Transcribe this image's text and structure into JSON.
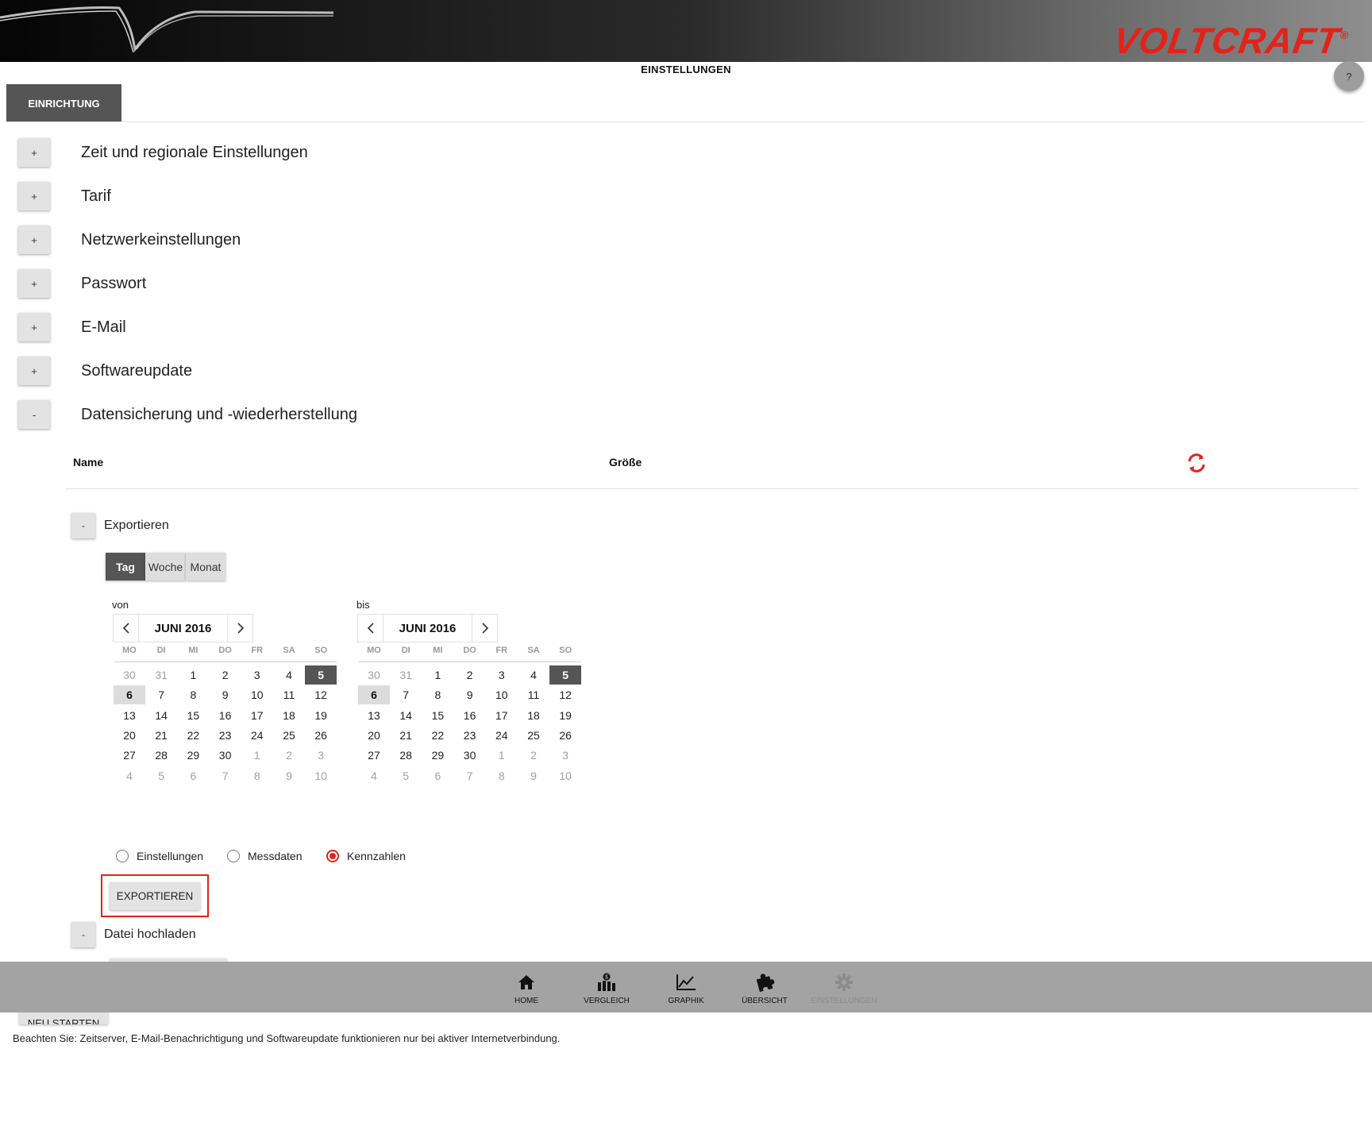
{
  "header": {
    "brand": "VOLTCRAFT",
    "registered": "®"
  },
  "page_title": "EINSTELLUNGEN",
  "help": {
    "label": "?"
  },
  "tabs": [
    {
      "label": "EINRICHTUNG"
    }
  ],
  "sections": [
    {
      "toggle": "+",
      "title": "Zeit und regionale Einstellungen"
    },
    {
      "toggle": "+",
      "title": "Tarif"
    },
    {
      "toggle": "+",
      "title": "Netzwerkeinstellungen"
    },
    {
      "toggle": "+",
      "title": "Passwort"
    },
    {
      "toggle": "+",
      "title": "E-Mail"
    },
    {
      "toggle": "+",
      "title": "Softwareupdate"
    },
    {
      "toggle": "-",
      "title": "Datensicherung und -wiederherstellung"
    }
  ],
  "backup_table": {
    "columns": [
      "Name",
      "Größe"
    ]
  },
  "export": {
    "toggle": "-",
    "title": "Exportieren",
    "periods": [
      "Tag",
      "Woche",
      "Monat"
    ],
    "active_period": "Tag",
    "from_label": "von",
    "to_label": "bis",
    "calendar": {
      "month": "JUNI 2016",
      "weekdays": [
        "MO",
        "DI",
        "MI",
        "DO",
        "FR",
        "SA",
        "SO"
      ],
      "weeks": [
        [
          "30",
          "31",
          "1",
          "2",
          "3",
          "4",
          "5"
        ],
        [
          "6",
          "7",
          "8",
          "9",
          "10",
          "11",
          "12"
        ],
        [
          "13",
          "14",
          "15",
          "16",
          "17",
          "18",
          "19"
        ],
        [
          "20",
          "21",
          "22",
          "23",
          "24",
          "25",
          "26"
        ],
        [
          "27",
          "28",
          "29",
          "30",
          "1",
          "2",
          "3"
        ],
        [
          "4",
          "5",
          "6",
          "7",
          "8",
          "9",
          "10"
        ]
      ],
      "selected_day": "5",
      "today": "6"
    },
    "options": [
      {
        "label": "Einstellungen",
        "checked": false
      },
      {
        "label": "Messdaten",
        "checked": false
      },
      {
        "label": "Kennzahlen",
        "checked": true
      }
    ],
    "button": "EXPORTIEREN"
  },
  "upload": {
    "toggle": "-",
    "title": "Datei hochladen"
  },
  "restart_button": "NEU STARTEN",
  "bottom_nav": [
    {
      "label": "HOME",
      "icon": "home-icon",
      "enabled": true
    },
    {
      "label": "VERGLEICH",
      "icon": "compare-icon",
      "enabled": true
    },
    {
      "label": "GRAPHIK",
      "icon": "chart-icon",
      "enabled": true
    },
    {
      "label": "ÜBERSICHT",
      "icon": "puzzle-icon",
      "enabled": true
    },
    {
      "label": "EINSTELLUNGEN",
      "icon": "gear-icon",
      "enabled": false
    }
  ],
  "note": "Beachten Sie: Zeitserver, E-Mail-Benachrichtigung und Softwareupdate funktionieren nur bei aktiver Internetverbindung.",
  "colors": {
    "accent": "#e2231a",
    "dark": "#555555",
    "navbar": "#a3a3a3"
  }
}
